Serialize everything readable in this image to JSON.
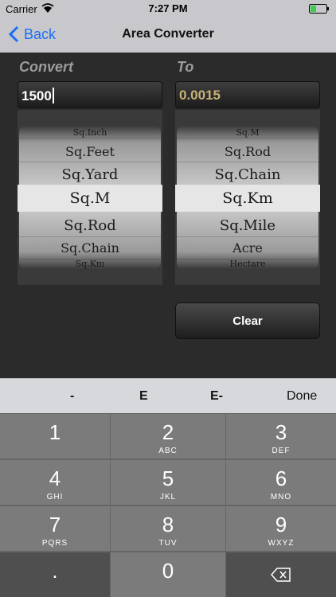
{
  "status": {
    "carrier": "Carrier",
    "time": "7:27 PM"
  },
  "nav": {
    "back_label": "Back",
    "title": "Area Converter"
  },
  "converter": {
    "from_label": "Convert",
    "to_label": "To",
    "input_value": "1500",
    "output_value": "0.0015",
    "from_units": [
      "Sq.Inch",
      "Sq.Feet",
      "Sq.Yard",
      "Sq.M",
      "Sq.Rod",
      "Sq.Chain",
      "Sq.Km"
    ],
    "from_selected": "Sq.M",
    "to_units": [
      "Sq.M",
      "Sq.Rod",
      "Sq.Chain",
      "Sq.Km",
      "Sq.Mile",
      "Acre",
      "Hectare"
    ],
    "to_selected": "Sq.Km",
    "clear_label": "Clear",
    "output_color": "#c9b27a"
  },
  "keyboard": {
    "accessory": {
      "minus": "-",
      "e": "E",
      "e_minus": "E-",
      "done": "Done"
    },
    "keys": [
      {
        "num": "1",
        "sub": ""
      },
      {
        "num": "2",
        "sub": "ABC"
      },
      {
        "num": "3",
        "sub": "DEF"
      },
      {
        "num": "4",
        "sub": "GHI"
      },
      {
        "num": "5",
        "sub": "JKL"
      },
      {
        "num": "6",
        "sub": "MNO"
      },
      {
        "num": "7",
        "sub": "PQRS"
      },
      {
        "num": "8",
        "sub": "TUV"
      },
      {
        "num": "9",
        "sub": "WXYZ"
      },
      {
        "num": ".",
        "sub": ""
      },
      {
        "num": "0",
        "sub": ""
      }
    ]
  },
  "accent_color": "#1a6ef5"
}
